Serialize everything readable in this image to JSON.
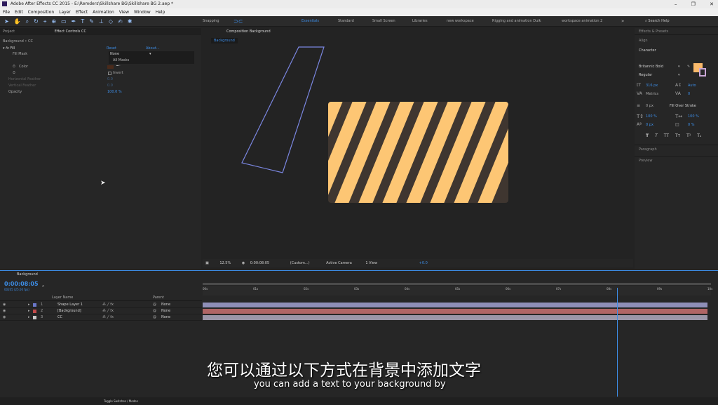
{
  "window": {
    "title": "Adobe After Effects CC 2015 - E:\\Remders\\Skillshare BG\\Skillshare BG 2.aep *"
  },
  "menu": [
    "File",
    "Edit",
    "Composition",
    "Layer",
    "Effect",
    "Animation",
    "View",
    "Window",
    "Help"
  ],
  "toolbar": {
    "snapping": "Snapping",
    "workspaces": [
      "Essentials",
      "Standard",
      "Small Screen",
      "Libraries",
      "new workspace",
      "Rigging and animation Duik",
      "workspace animation 2"
    ],
    "search_placeholder": "Search Help"
  },
  "left_panel": {
    "tabs": [
      "Project",
      "Effect Controls CC"
    ],
    "layer_path": "Background • CC",
    "effect_name": "Fill",
    "reset": "Reset",
    "about": "About...",
    "fill_mask_label": "Fill Mask",
    "fill_mask_value": "None",
    "dropdown_options": [
      "All Masks"
    ],
    "color_label": "Color",
    "invert_label": "Invert",
    "h_feather_label": "Horizontal Feather",
    "h_feather_value": "0.0",
    "v_feather_label": "Vertical Feather",
    "v_feather_value": "0.0",
    "opacity_label": "Opacity",
    "opacity_value": "100.0 %"
  },
  "comp": {
    "tab": "Composition Background",
    "sub_tab": "Background",
    "zoom": "12.5%",
    "timecode": "0:00:08:05",
    "resolution": "(Custom...)",
    "camera": "Active Camera",
    "views": "1 View",
    "exposure": "+0.0"
  },
  "right_panel": {
    "effects_presets": "Effects & Presets",
    "align": "Align",
    "character": "Character",
    "font": "Britannic Bold",
    "style": "Regular",
    "size": "316 px",
    "leading": "Auto",
    "kerning": "Metrics",
    "tracking": "0",
    "stroke_width": "0 px",
    "stroke_mode": "Fill Over Stroke",
    "vscale": "100 %",
    "hscale": "100 %",
    "baseline": "0 px",
    "tsume": "0 %",
    "paragraph": "Paragraph",
    "preview": "Preview",
    "colors": {
      "fill": "#f9b96b",
      "accent": "#c9a7d6"
    }
  },
  "timeline": {
    "tab": "Background",
    "timecode": "0:00:08:05",
    "fps": "00205 (25.00 fps)",
    "headers": {
      "layer_name": "Layer Name",
      "parent": "Parent"
    },
    "layers": [
      {
        "num": "1",
        "name": "Shape Layer 1",
        "color": "#6a77c8",
        "parent": "None",
        "bar": "#8f8fb8"
      },
      {
        "num": "2",
        "name": "[Background]",
        "color": "#c24a4a",
        "parent": "None",
        "bar": "#b06565"
      },
      {
        "num": "3",
        "name": "CC",
        "color": "#c8c8c8",
        "parent": "None",
        "bar": "#9b96a8"
      }
    ],
    "ruler": [
      "00s",
      "01s",
      "02s",
      "03s",
      "04s",
      "05s",
      "06s",
      "07s",
      "08s",
      "09s",
      "10s"
    ],
    "toggle_label": "Toggle Switches / Modes"
  },
  "subtitles": {
    "zh": "您可以通过以下方式在背景中添加文字",
    "en": "you can add a text to your background by"
  },
  "stripe_colors": {
    "light": "#fdc674",
    "dark": "#3f3630"
  }
}
